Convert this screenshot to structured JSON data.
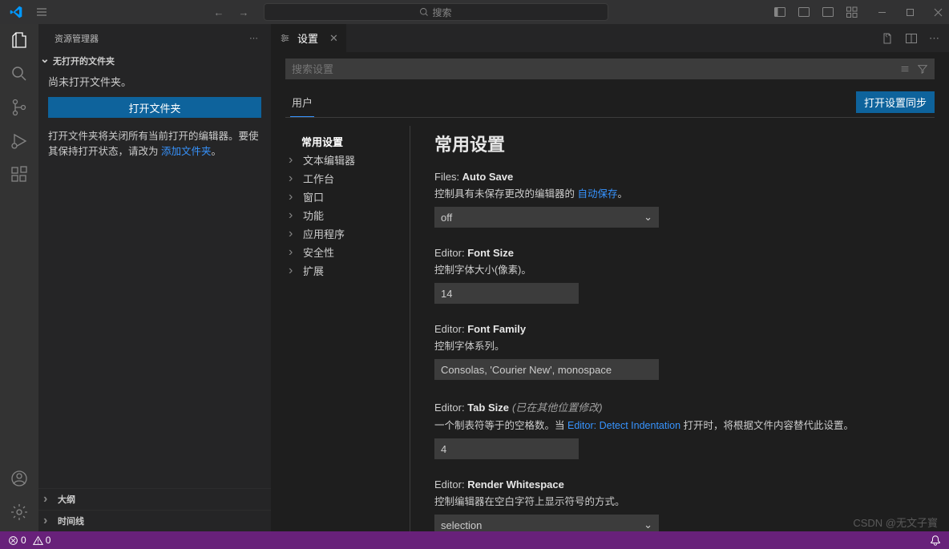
{
  "titlebar": {
    "search_placeholder": "搜索"
  },
  "sidebar": {
    "title": "资源管理器",
    "section": "无打开的文件夹",
    "no_folder_msg": "尚未打开文件夹。",
    "open_folder_btn": "打开文件夹",
    "hint_prefix": "打开文件夹将关闭所有当前打开的编辑器。要使其保持打开状态，请改为 ",
    "hint_link": "添加文件夹",
    "hint_suffix": "。",
    "outline": "大纲",
    "timeline": "时间线"
  },
  "tab": {
    "label": "设置"
  },
  "settings": {
    "search_placeholder": "搜索设置",
    "scope_user": "用户",
    "sync_btn": "打开设置同步",
    "toc": {
      "common": "常用设置",
      "text_editor": "文本编辑器",
      "workbench": "工作台",
      "window": "窗口",
      "features": "功能",
      "application": "应用程序",
      "security": "安全性",
      "extensions": "扩展"
    },
    "heading": "常用设置",
    "autosave": {
      "prefix": "Files: ",
      "name": "Auto Save",
      "desc_prefix": "控制具有未保存更改的编辑器的 ",
      "desc_link": "自动保存",
      "desc_suffix": "。",
      "value": "off"
    },
    "fontsize": {
      "prefix": "Editor: ",
      "name": "Font Size",
      "desc": "控制字体大小(像素)。",
      "value": "14"
    },
    "fontfamily": {
      "prefix": "Editor: ",
      "name": "Font Family",
      "desc": "控制字体系列。",
      "value": "Consolas, 'Courier New', monospace"
    },
    "tabsize": {
      "prefix": "Editor: ",
      "name": "Tab Size",
      "modified": "(已在其他位置修改)",
      "desc_prefix": "一个制表符等于的空格数。当 ",
      "desc_link": "Editor: Detect Indentation",
      "desc_suffix": " 打开时，将根据文件内容替代此设置。",
      "value": "4"
    },
    "whitespace": {
      "prefix": "Editor: ",
      "name": "Render Whitespace",
      "desc": "控制编辑器在空白字符上显示符号的方式。",
      "value": "selection"
    }
  },
  "statusbar": {
    "errors": "0",
    "warnings": "0"
  },
  "watermark": "CSDN @无文子寳"
}
